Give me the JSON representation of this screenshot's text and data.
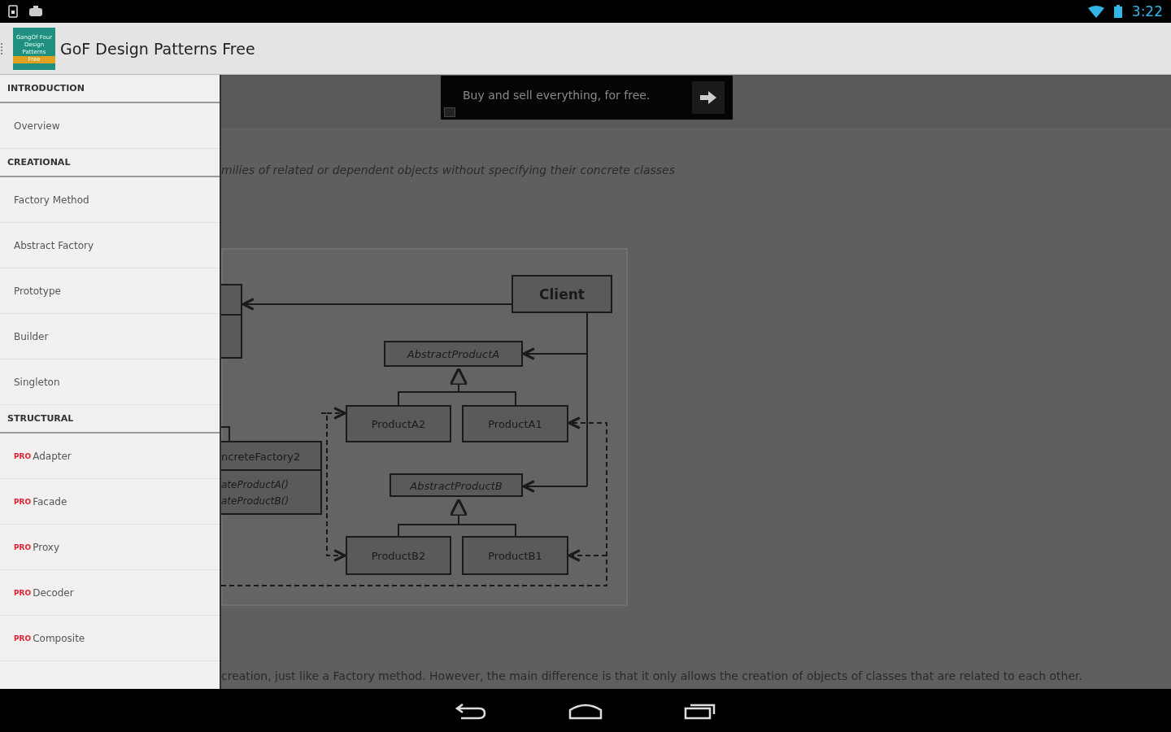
{
  "status_bar": {
    "time": "3:22"
  },
  "action_bar": {
    "logo_lines": [
      "GangOf Four",
      "Design",
      "Patterns",
      "Free"
    ],
    "title": "GoF Design Patterns Free"
  },
  "drawer": {
    "sections": [
      {
        "header": "INTRODUCTION",
        "items": [
          {
            "label": "Overview"
          }
        ]
      },
      {
        "header": "CREATIONAL",
        "items": [
          {
            "label": "Factory Method"
          },
          {
            "label": "Abstract Factory"
          },
          {
            "label": "Prototype"
          },
          {
            "label": "Builder"
          },
          {
            "label": "Singleton"
          }
        ]
      },
      {
        "header": "STRUCTURAL",
        "items": [
          {
            "label": "Adapter",
            "badge": "PRO"
          },
          {
            "label": "Facade",
            "badge": "PRO"
          },
          {
            "label": "Proxy",
            "badge": "PRO"
          },
          {
            "label": "Decoder",
            "badge": "PRO"
          },
          {
            "label": "Composite",
            "badge": "PRO"
          }
        ]
      }
    ]
  },
  "ad_banner": {
    "text": "Buy and sell everything, for free."
  },
  "content": {
    "intent_text": "milies of related or dependent objects without specifying their concrete classes",
    "diagram": {
      "client": "Client",
      "abstract_product_a": "AbstractProductA",
      "product_a2": "ProductA2",
      "product_a1": "ProductA1",
      "abstract_product_b": "AbstractProductB",
      "product_b2": "ProductB2",
      "product_b1": "ProductB1",
      "factory_name": "ncreteFactory2",
      "factory_methods": [
        "ateProductA()",
        "ateProductB()"
      ]
    },
    "description": "creation, just like a Factory method. However, the main difference is that it only allows the creation of objects of classes that are related to each other."
  }
}
